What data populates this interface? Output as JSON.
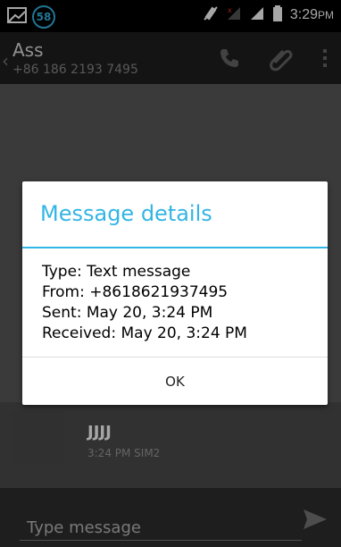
{
  "statusbar": {
    "notification_count": "58",
    "time": "3:29",
    "time_suffix": "PM"
  },
  "actionbar": {
    "contact_name": "Ass",
    "contact_number": "+86 186 2193 7495"
  },
  "thread": {
    "message": {
      "text": "JJJJ",
      "meta": "3:24 PM SIM2"
    }
  },
  "compose": {
    "placeholder": "Type message"
  },
  "dialog": {
    "title": "Message details",
    "lines": [
      "Type: Text message",
      "From: +8618621937495",
      "Sent: May 20, 3:24 PM",
      "Received: May 20, 3:24 PM"
    ],
    "ok_label": "OK"
  },
  "colors": {
    "accent": "#33b5e5",
    "statusbar_bg": "#000000",
    "actionbar_bg": "#202020"
  }
}
